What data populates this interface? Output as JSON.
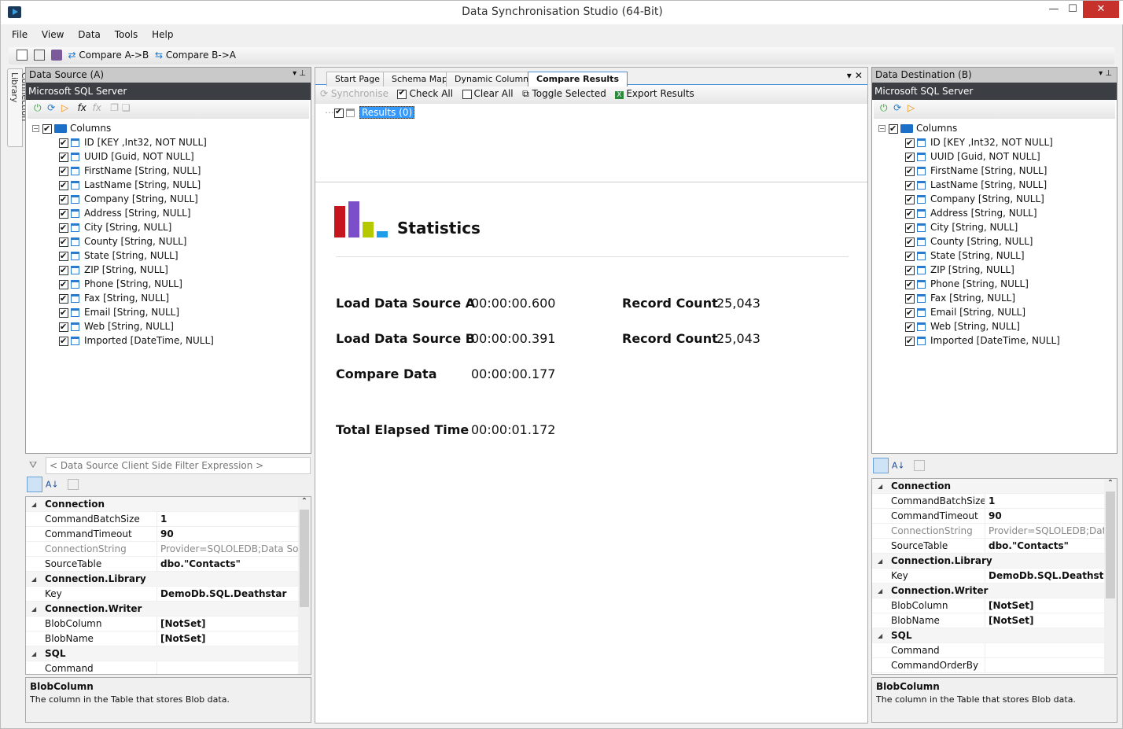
{
  "window": {
    "title": "Data Synchronisation Studio (64-Bit)",
    "minimize": "—",
    "maximize": "☐",
    "close": "✕"
  },
  "menu": [
    "File",
    "View",
    "Data",
    "Tools",
    "Help"
  ],
  "toolbar": {
    "compare_ab": "Compare A->B",
    "compare_ba": "Compare B->A"
  },
  "side_tab": "Connection Library",
  "columns": [
    "ID [KEY ,Int32, NOT NULL]",
    "UUID [Guid, NOT NULL]",
    "FirstName [String, NULL]",
    "LastName [String, NULL]",
    "Company [String, NULL]",
    "Address [String, NULL]",
    "City [String, NULL]",
    "County [String, NULL]",
    "State [String, NULL]",
    "ZIP [String, NULL]",
    "Phone [String, NULL]",
    "Fax [String, NULL]",
    "Email [String, NULL]",
    "Web [String, NULL]",
    "Imported [DateTime, NULL]"
  ],
  "source": {
    "title": "Data Source (A)",
    "provider": "Microsoft SQL Server",
    "root": "Columns",
    "filter_placeholder": "< Data Source Client Side Filter Expression >",
    "props": [
      {
        "k": "Connection",
        "cat": true
      },
      {
        "k": "CommandBatchSize",
        "v": "1"
      },
      {
        "k": "CommandTimeout",
        "v": "90"
      },
      {
        "k": "ConnectionString",
        "v": "Provider=SQLOLEDB;Data Source",
        "grey": true
      },
      {
        "k": "SourceTable",
        "v": "dbo.\"Contacts\""
      },
      {
        "k": "Connection.Library",
        "cat": true
      },
      {
        "k": "Key",
        "v": "DemoDb.SQL.Deathstar"
      },
      {
        "k": "Connection.Writer",
        "cat": true
      },
      {
        "k": "BlobColumn",
        "v": "[NotSet]"
      },
      {
        "k": "BlobName",
        "v": "[NotSet]"
      },
      {
        "k": "SQL",
        "cat": true
      },
      {
        "k": "Command",
        "v": ""
      }
    ],
    "desc_title": "BlobColumn",
    "desc_text": "The column in the Table that stores Blob data."
  },
  "dest": {
    "title": "Data Destination (B)",
    "provider": "Microsoft SQL Server",
    "root": "Columns",
    "props": [
      {
        "k": "Connection",
        "cat": true
      },
      {
        "k": "CommandBatchSize",
        "v": "1"
      },
      {
        "k": "CommandTimeout",
        "v": "90"
      },
      {
        "k": "ConnectionString",
        "v": "Provider=SQLOLEDB;Data S",
        "grey": true
      },
      {
        "k": "SourceTable",
        "v": "dbo.\"Contacts\""
      },
      {
        "k": "Connection.Library",
        "cat": true
      },
      {
        "k": "Key",
        "v": "DemoDb.SQL.Deathstar"
      },
      {
        "k": "Connection.Writer",
        "cat": true
      },
      {
        "k": "BlobColumn",
        "v": "[NotSet]"
      },
      {
        "k": "BlobName",
        "v": "[NotSet]"
      },
      {
        "k": "SQL",
        "cat": true
      },
      {
        "k": "Command",
        "v": ""
      },
      {
        "k": "CommandOrderBy",
        "v": ""
      }
    ],
    "desc_title": "BlobColumn",
    "desc_text": "The column in the Table that stores Blob data."
  },
  "center": {
    "tabs": [
      "Start Page",
      "Schema Map",
      "Dynamic Columns",
      "Compare Results"
    ],
    "active_tab": "Compare Results",
    "actions": {
      "synchronise": "Synchronise",
      "check_all": "Check All",
      "clear_all": "Clear All",
      "toggle": "Toggle Selected",
      "export": "Export Results"
    },
    "results_node": "Results (0)",
    "stats": {
      "heading": "Statistics",
      "load_a_label": "Load Data Source A",
      "load_a_time": "00:00:00.600",
      "count_label_a": "Record Count",
      "count_a": "25,043",
      "load_b_label": "Load Data Source B",
      "load_b_time": "00:00:00.391",
      "count_label_b": "Record Count",
      "count_b": "25,043",
      "compare_label": "Compare Data",
      "compare_time": "00:00:00.177",
      "total_label": "Total Elapsed Time",
      "total_time": "00:00:01.172"
    }
  },
  "colors": {
    "accent": "#3399ff",
    "header_dark": "#3b3f44",
    "bar1": "#c4161c",
    "bar2": "#7b4fc9",
    "bar3": "#b5c800",
    "bar4": "#1e9ee8"
  }
}
